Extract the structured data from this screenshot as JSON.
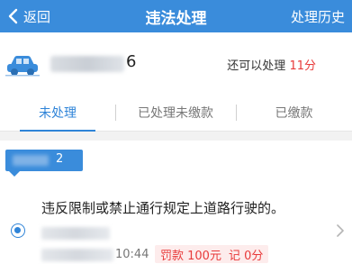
{
  "header": {
    "back_label": "返回",
    "title": "违法处理",
    "history_label": "处理历史",
    "bg_color": "#3A8CDB"
  },
  "vehicle": {
    "plate_tail": "6",
    "points_prefix": "还可以处理",
    "points_value": "11分",
    "icon": "car-icon"
  },
  "tabs": [
    {
      "label": "未处理",
      "active": true
    },
    {
      "label": "已处理未缴款",
      "active": false
    },
    {
      "label": "已缴款",
      "active": false
    }
  ],
  "group": {
    "count": "2"
  },
  "violation": {
    "description": "违反限制或禁止通行规定上道路行驶的。",
    "time": "10:44",
    "fine": "罚款 100元",
    "points": "记 0分",
    "selected": true
  },
  "colors": {
    "accent": "#2F84D8",
    "alert": "#E83A3A"
  }
}
